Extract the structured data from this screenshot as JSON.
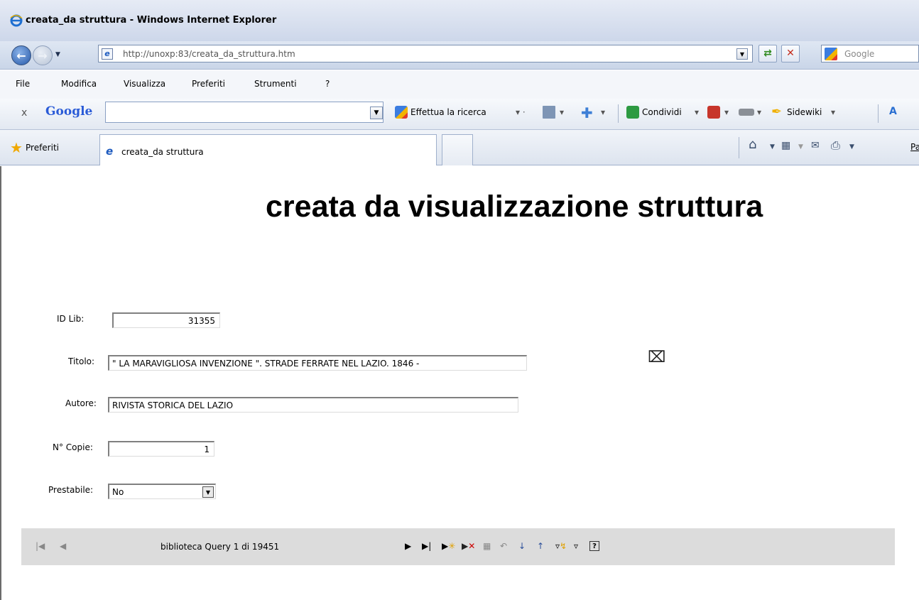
{
  "window": {
    "title": "creata_da struttura - Windows Internet Explorer"
  },
  "address_bar": {
    "url": "http://unoxp:83/creata_da_struttura.htm",
    "search_placeholder": "Google"
  },
  "menu": {
    "items": [
      "File",
      "Modifica",
      "Visualizza",
      "Preferiti",
      "Strumenti",
      "?"
    ]
  },
  "google_toolbar": {
    "close": "x",
    "logo": "Google",
    "search_value": "",
    "items": {
      "search_label": "Effettua la ricerca",
      "share_label": "Condividi",
      "sidewiki_label": "Sidewiki"
    }
  },
  "favorites_bar": {
    "label": "Preferiti",
    "tab_label": "creata_da struttura",
    "page_label": "Pa"
  },
  "page": {
    "heading": "creata da visualizzazione struttura",
    "fields": {
      "id_lib": {
        "label": "ID Lib:",
        "value": "31355"
      },
      "titolo": {
        "label": "Titolo:",
        "value": "\" LA MARAVIGLIOSA INVENZIONE \". STRADE FERRATE NEL LAZIO. 1846 -"
      },
      "autore": {
        "label": "Autore:",
        "value": "RIVISTA STORICA DEL LAZIO"
      },
      "copie": {
        "label": "N° Copie:",
        "value": "1"
      },
      "prestabile": {
        "label": "Prestabile:",
        "value": "No"
      }
    },
    "record_nav": {
      "status": "biblioteca Query 1 di 19451"
    }
  },
  "icons": {
    "back": "back-arrow-icon",
    "forward": "forward-arrow-icon",
    "refresh": "refresh-icon",
    "stop": "stop-icon",
    "favorites": "star-icon",
    "home": "home-icon",
    "feeds": "rss-icon",
    "mail": "mail-icon",
    "print": "printer-icon"
  },
  "colors": {
    "accent": "#2558a8",
    "nav_bar_bg": "#dcdcdc"
  }
}
